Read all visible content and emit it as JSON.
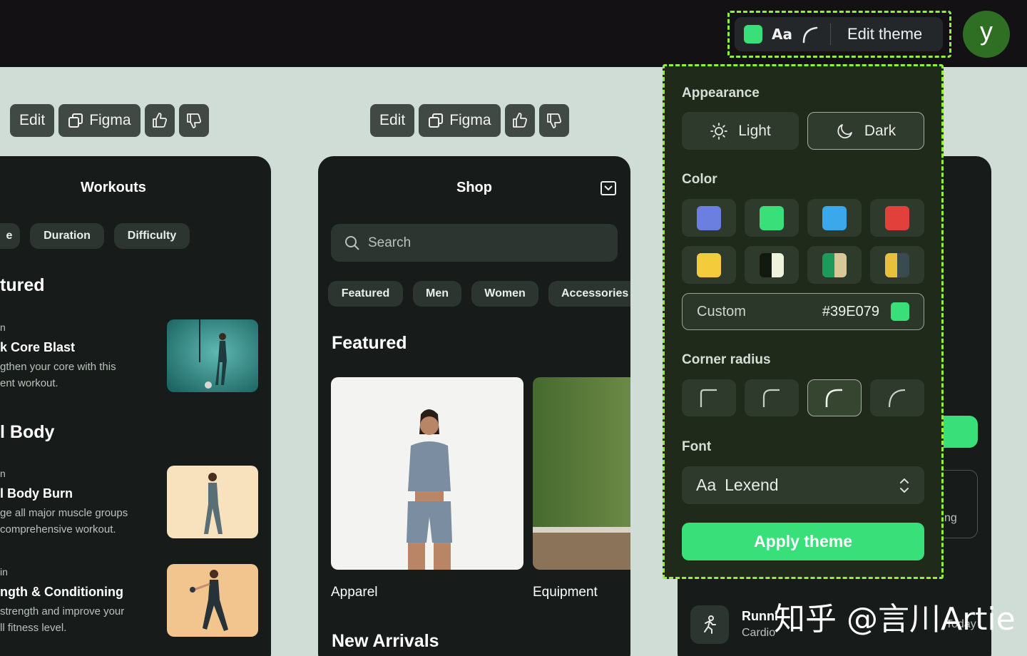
{
  "header": {
    "theme_label": "Edit theme",
    "font_glyph": "Aa",
    "avatar_letter": "y",
    "accent": "#39E079"
  },
  "preview_toolbar": {
    "edit": "Edit",
    "figma": "Figma"
  },
  "workouts": {
    "title": "Workouts",
    "chips": [
      "e",
      "Duration",
      "Difficulty"
    ],
    "section_featured": "tured",
    "section_full": "l Body",
    "items": [
      {
        "label": "n",
        "name": "k Core Blast",
        "desc_1": "gthen your core with this",
        "desc_2": "ent workout."
      },
      {
        "label": "n",
        "name": "l Body Burn",
        "desc_1": "ge all major muscle groups",
        "desc_2": "comprehensive workout."
      },
      {
        "label": "in",
        "name": "ngth & Conditioning",
        "desc_1": "strength and improve your",
        "desc_2": "ll fitness level."
      }
    ]
  },
  "shop": {
    "title": "Shop",
    "search_placeholder": "Search",
    "chips": [
      "Featured",
      "Men",
      "Women",
      "Accessories"
    ],
    "section_featured": "Featured",
    "cards": [
      "Apparel",
      "Equipment"
    ],
    "section_new": "New Arrivals"
  },
  "third_phone": {
    "partial_text": "ng",
    "activity_name": "Runni",
    "activity_type": "Cardio",
    "activity_time": "Today"
  },
  "theme_panel": {
    "appearance_label": "Appearance",
    "light": "Light",
    "dark": "Dark",
    "selected_mode": "Dark",
    "color_label": "Color",
    "swatches": [
      {
        "name": "purple-blue",
        "colors": [
          "#6b7fe0"
        ]
      },
      {
        "name": "green",
        "colors": [
          "#39e079"
        ]
      },
      {
        "name": "sky-blue",
        "colors": [
          "#3aa8ea"
        ]
      },
      {
        "name": "red",
        "colors": [
          "#e2403a"
        ]
      },
      {
        "name": "yellow",
        "colors": [
          "#f2cc3b"
        ]
      },
      {
        "name": "black-cream",
        "colors": [
          "#121a10",
          "#eef3dc"
        ]
      },
      {
        "name": "green-tan",
        "colors": [
          "#1e9a5a",
          "#d8c898"
        ]
      },
      {
        "name": "gold-slate",
        "colors": [
          "#e8c13c",
          "#394a50"
        ]
      }
    ],
    "custom_label": "Custom",
    "custom_hex": "#39E079",
    "corner_label": "Corner radius",
    "corner_selected": 3,
    "font_label": "Font",
    "font_prefix": "Aa",
    "font_value": "Lexend",
    "apply_label": "Apply theme"
  },
  "watermark": "知乎 @言川Artie"
}
